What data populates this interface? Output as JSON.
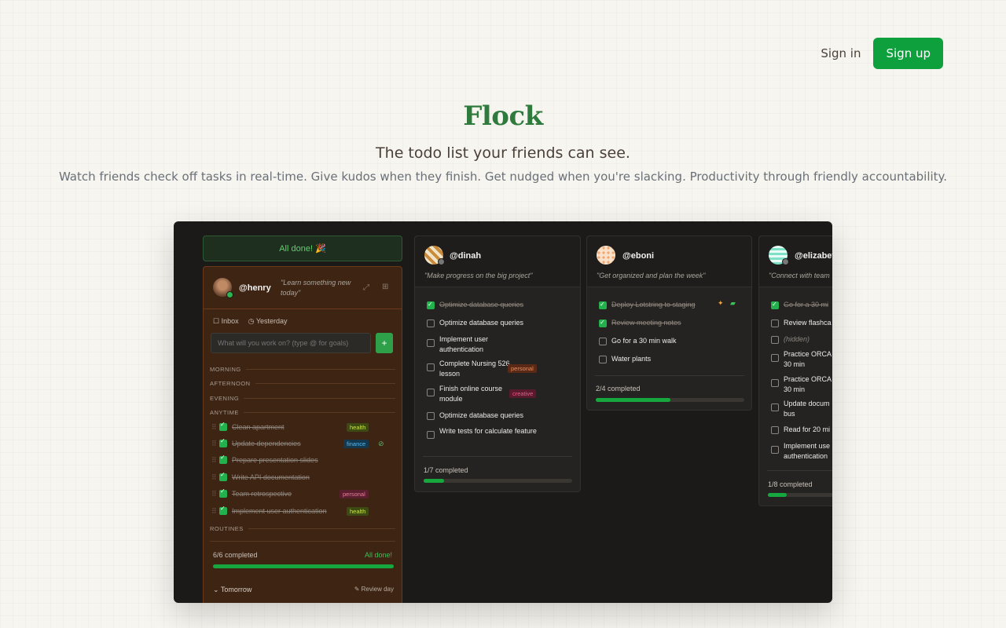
{
  "nav": {
    "signin": "Sign in",
    "signup": "Sign up"
  },
  "hero": {
    "brand": "Flock",
    "tagline": "The todo list your friends can see.",
    "subtagline": "Watch friends check off tasks in real-time. Give kudos when they finish. Get nudged when you're slacking. Productivity through friendly accountability."
  },
  "colors": {
    "accent": "#0da03c",
    "brand": "#2f7a3d"
  },
  "demo": {
    "banner": "All done! 🎉",
    "me": {
      "handle": "@henry",
      "quote": "\"Learn something new today\"",
      "tab_inbox": "Inbox",
      "tab_yesterday": "Yesterday",
      "input_placeholder": "What will you work on? (type @ for goals)",
      "add_label": "+",
      "sections": [
        "MORNING",
        "AFTERNOON",
        "EVENING",
        "ANYTIME",
        "ROUTINES"
      ],
      "tasks": [
        {
          "text": "Clean apartment",
          "tag": "health"
        },
        {
          "text": "Update dependencies",
          "tag": "finance"
        },
        {
          "text": "Prepare presentation slides",
          "tag": ""
        },
        {
          "text": "Write API documentation",
          "tag": ""
        },
        {
          "text": "Team retrospective",
          "tag": "personal"
        },
        {
          "text": "Implement user authentication",
          "tag": "health"
        }
      ],
      "progress_text": "6/6 completed",
      "progress_status": "All done!",
      "progress": 1.0,
      "tomorrow": "Tomorrow",
      "review": "Review day"
    },
    "friends": [
      {
        "handle": "@dinah",
        "quote": "\"Make progress on the big project\"",
        "tasks": [
          {
            "text": "Optimize database queries",
            "done": true
          },
          {
            "text": "Optimize database queries",
            "done": false
          },
          {
            "text": "Implement user authentication",
            "done": false
          },
          {
            "text": "Complete Nursing 526 lesson",
            "done": false,
            "tag": "personal"
          },
          {
            "text": "Finish online course module",
            "done": false,
            "tag": "creative"
          },
          {
            "text": "Optimize database queries",
            "done": false
          },
          {
            "text": "Write tests for calculate feature",
            "done": false
          }
        ],
        "progress_text": "1/7 completed",
        "progress": 0.14
      },
      {
        "handle": "@eboni",
        "quote": "\"Get organized and plan the week\"",
        "tasks": [
          {
            "text": "Deploy Lotstring to staging",
            "done": true
          },
          {
            "text": "Review meeting notes",
            "done": true
          },
          {
            "text": "Go for a 30 min walk",
            "done": false
          },
          {
            "text": "Water plants",
            "done": false
          }
        ],
        "progress_text": "2/4 completed",
        "progress": 0.5
      },
      {
        "handle": "@elizabet",
        "quote": "\"Connect with team",
        "tasks": [
          {
            "text": "Go for a 30 mi",
            "done": true
          },
          {
            "text": "Review flashca",
            "done": false
          },
          {
            "text": "(hidden)",
            "done": false
          },
          {
            "text": "Practice ORCA 30 min",
            "done": false
          },
          {
            "text": "Practice ORCA 30 min",
            "done": false
          },
          {
            "text": "Update docum bus",
            "done": false
          },
          {
            "text": "Read for 20 mi",
            "done": false
          },
          {
            "text": "Implement use authentication",
            "done": false
          }
        ],
        "progress_text": "1/8 completed",
        "progress": 0.125
      }
    ]
  }
}
